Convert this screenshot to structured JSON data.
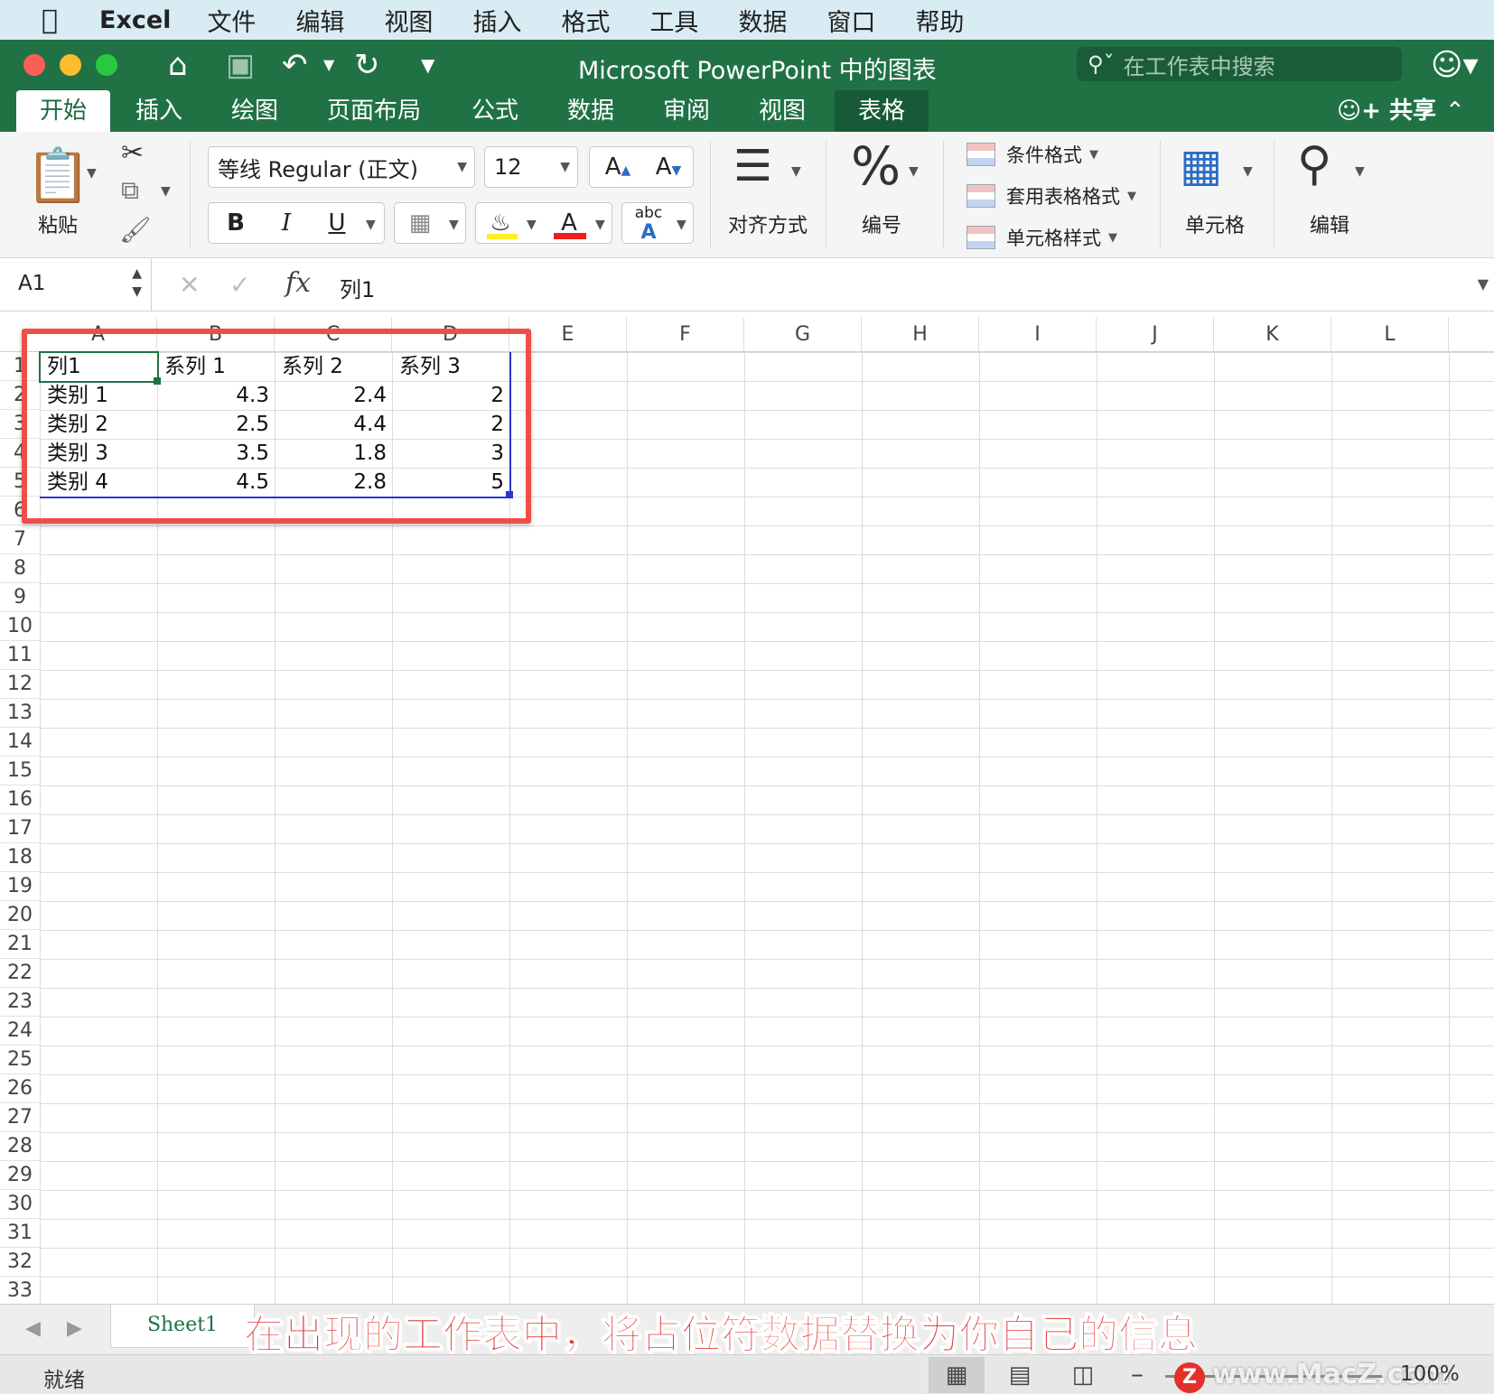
{
  "menubar": {
    "apple": "",
    "app_name": "Excel",
    "items": [
      "文件",
      "编辑",
      "视图",
      "插入",
      "格式",
      "工具",
      "数据",
      "窗口",
      "帮助"
    ]
  },
  "titlebar": {
    "title": "Microsoft PowerPoint 中的图表",
    "search_placeholder": "在工作表中搜索"
  },
  "tabs": [
    "开始",
    "插入",
    "绘图",
    "页面布局",
    "公式",
    "数据",
    "审阅",
    "视图",
    "表格"
  ],
  "active_tab": "开始",
  "share_label": "共享",
  "ribbon": {
    "paste": "粘贴",
    "font_name": "等线 Regular (正文)",
    "font_size": "12",
    "bold": "B",
    "italic": "I",
    "underline": "U",
    "grow_font": "A",
    "shrink_font": "A",
    "font_color_glyph": "A",
    "abc_glyph": "abc",
    "align": "对齐方式",
    "number_glyph": "%",
    "number": "编号",
    "conditional_format": "条件格式",
    "format_as_table": "套用表格格式",
    "cell_styles": "单元格样式",
    "cells": "单元格",
    "editing": "编辑"
  },
  "formula_bar": {
    "name_box": "A1",
    "fx": "fx",
    "content": "列1"
  },
  "columns": [
    "A",
    "B",
    "C",
    "D",
    "E",
    "F",
    "G",
    "H",
    "I",
    "J",
    "K",
    "L"
  ],
  "rows": [
    "1",
    "2",
    "3",
    "4",
    "5",
    "6",
    "7",
    "8",
    "9",
    "10",
    "11",
    "12",
    "13",
    "14",
    "15",
    "16",
    "17",
    "18",
    "19",
    "20",
    "21",
    "22",
    "23",
    "24",
    "25",
    "26",
    "27",
    "28",
    "29",
    "30",
    "31",
    "32",
    "33"
  ],
  "table": {
    "header": [
      "列1",
      "系列 1",
      "系列 2",
      "系列 3"
    ],
    "rows": [
      [
        "类别 1",
        "4.3",
        "2.4",
        "2"
      ],
      [
        "类别 2",
        "2.5",
        "4.4",
        "2"
      ],
      [
        "类别 3",
        "3.5",
        "1.8",
        "3"
      ],
      [
        "类别 4",
        "4.5",
        "2.8",
        "5"
      ]
    ]
  },
  "sheet_tab": "Sheet1",
  "caption": "在出现的工作表中，将占位符数据替换为你自己的信息",
  "status": {
    "text": "就绪",
    "zoom": "100%",
    "watermark": "www.MacZ.com",
    "watermark_badge": "Z"
  },
  "colors": {
    "excel_green": "#207245",
    "highlight_red": "#ef4e48",
    "table_border_blue": "#2b36c9",
    "caption_red": "#e3302b"
  }
}
